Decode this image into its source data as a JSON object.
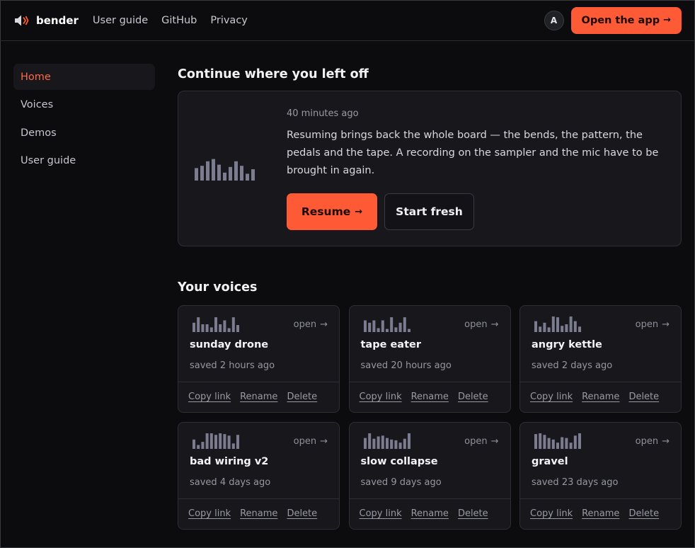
{
  "header": {
    "brand_name": "bender",
    "brand_icon": "speaker-icon",
    "nav": [
      {
        "label": "User guide"
      },
      {
        "label": "GitHub"
      },
      {
        "label": "Privacy"
      }
    ],
    "avatar_initial": "A",
    "open_app_label": "Open the app",
    "arrow_glyph": "→"
  },
  "sidebar": {
    "items": [
      {
        "label": "Home",
        "active": true
      },
      {
        "label": "Voices",
        "active": false
      },
      {
        "label": "Demos",
        "active": false
      },
      {
        "label": "User guide",
        "active": false
      }
    ]
  },
  "continue": {
    "title": "Continue where you left off",
    "time_ago": "40 minutes ago",
    "description": "Resuming brings back the whole board — the bends, the pattern, the pedals and the tape. A recording on the sampler and the mic have to be brought in again.",
    "resume_label": "Resume",
    "fresh_label": "Start fresh",
    "wave_levels": [
      0.55,
      0.65,
      0.85,
      0.95,
      0.7,
      0.35,
      0.6,
      0.85,
      0.65,
      0.3,
      0.5
    ]
  },
  "voices": {
    "title": "Your voices",
    "open_label": "open",
    "actions": {
      "copy": "Copy link",
      "rename": "Rename",
      "delete": "Delete"
    },
    "items": [
      {
        "name": "sunday drone",
        "saved": "saved 2 hours ago",
        "wave": [
          0.6,
          0.95,
          0.5,
          0.5,
          0.3,
          0.95,
          0.5,
          0.75,
          0.25,
          0.95,
          0.45
        ]
      },
      {
        "name": "tape eater",
        "saved": "saved 20 hours ago",
        "wave": [
          0.75,
          0.6,
          0.75,
          0.25,
          0.75,
          0.2,
          0.95,
          0.3,
          0.6,
          0.95,
          0.2
        ]
      },
      {
        "name": "angry kettle",
        "saved": "saved 2 days ago",
        "wave": [
          0.7,
          0.35,
          0.6,
          0.3,
          1.0,
          0.95,
          0.4,
          0.5,
          1.0,
          0.7,
          0.35
        ]
      },
      {
        "name": "bad wiring v2",
        "saved": "saved 4 days ago",
        "wave": [
          0.6,
          0.25,
          0.45,
          1.0,
          1.0,
          0.9,
          1.0,
          0.95,
          0.85,
          0.35,
          0.9
        ]
      },
      {
        "name": "slow collapse",
        "saved": "saved 9 days ago",
        "wave": [
          0.7,
          1.0,
          0.65,
          0.8,
          0.85,
          0.7,
          0.6,
          0.55,
          0.4,
          0.65,
          1.0
        ]
      },
      {
        "name": "gravel",
        "saved": "saved 23 days ago",
        "wave": [
          0.95,
          1.0,
          0.9,
          0.7,
          0.6,
          0.4,
          0.75,
          0.7,
          0.4,
          0.85,
          1.0
        ]
      }
    ]
  },
  "colors": {
    "accent": "#ff5a36",
    "accent_text": "#ff6a46",
    "background": "#0c0c0e",
    "card": "#17171c",
    "wave": "#7c7c91"
  }
}
